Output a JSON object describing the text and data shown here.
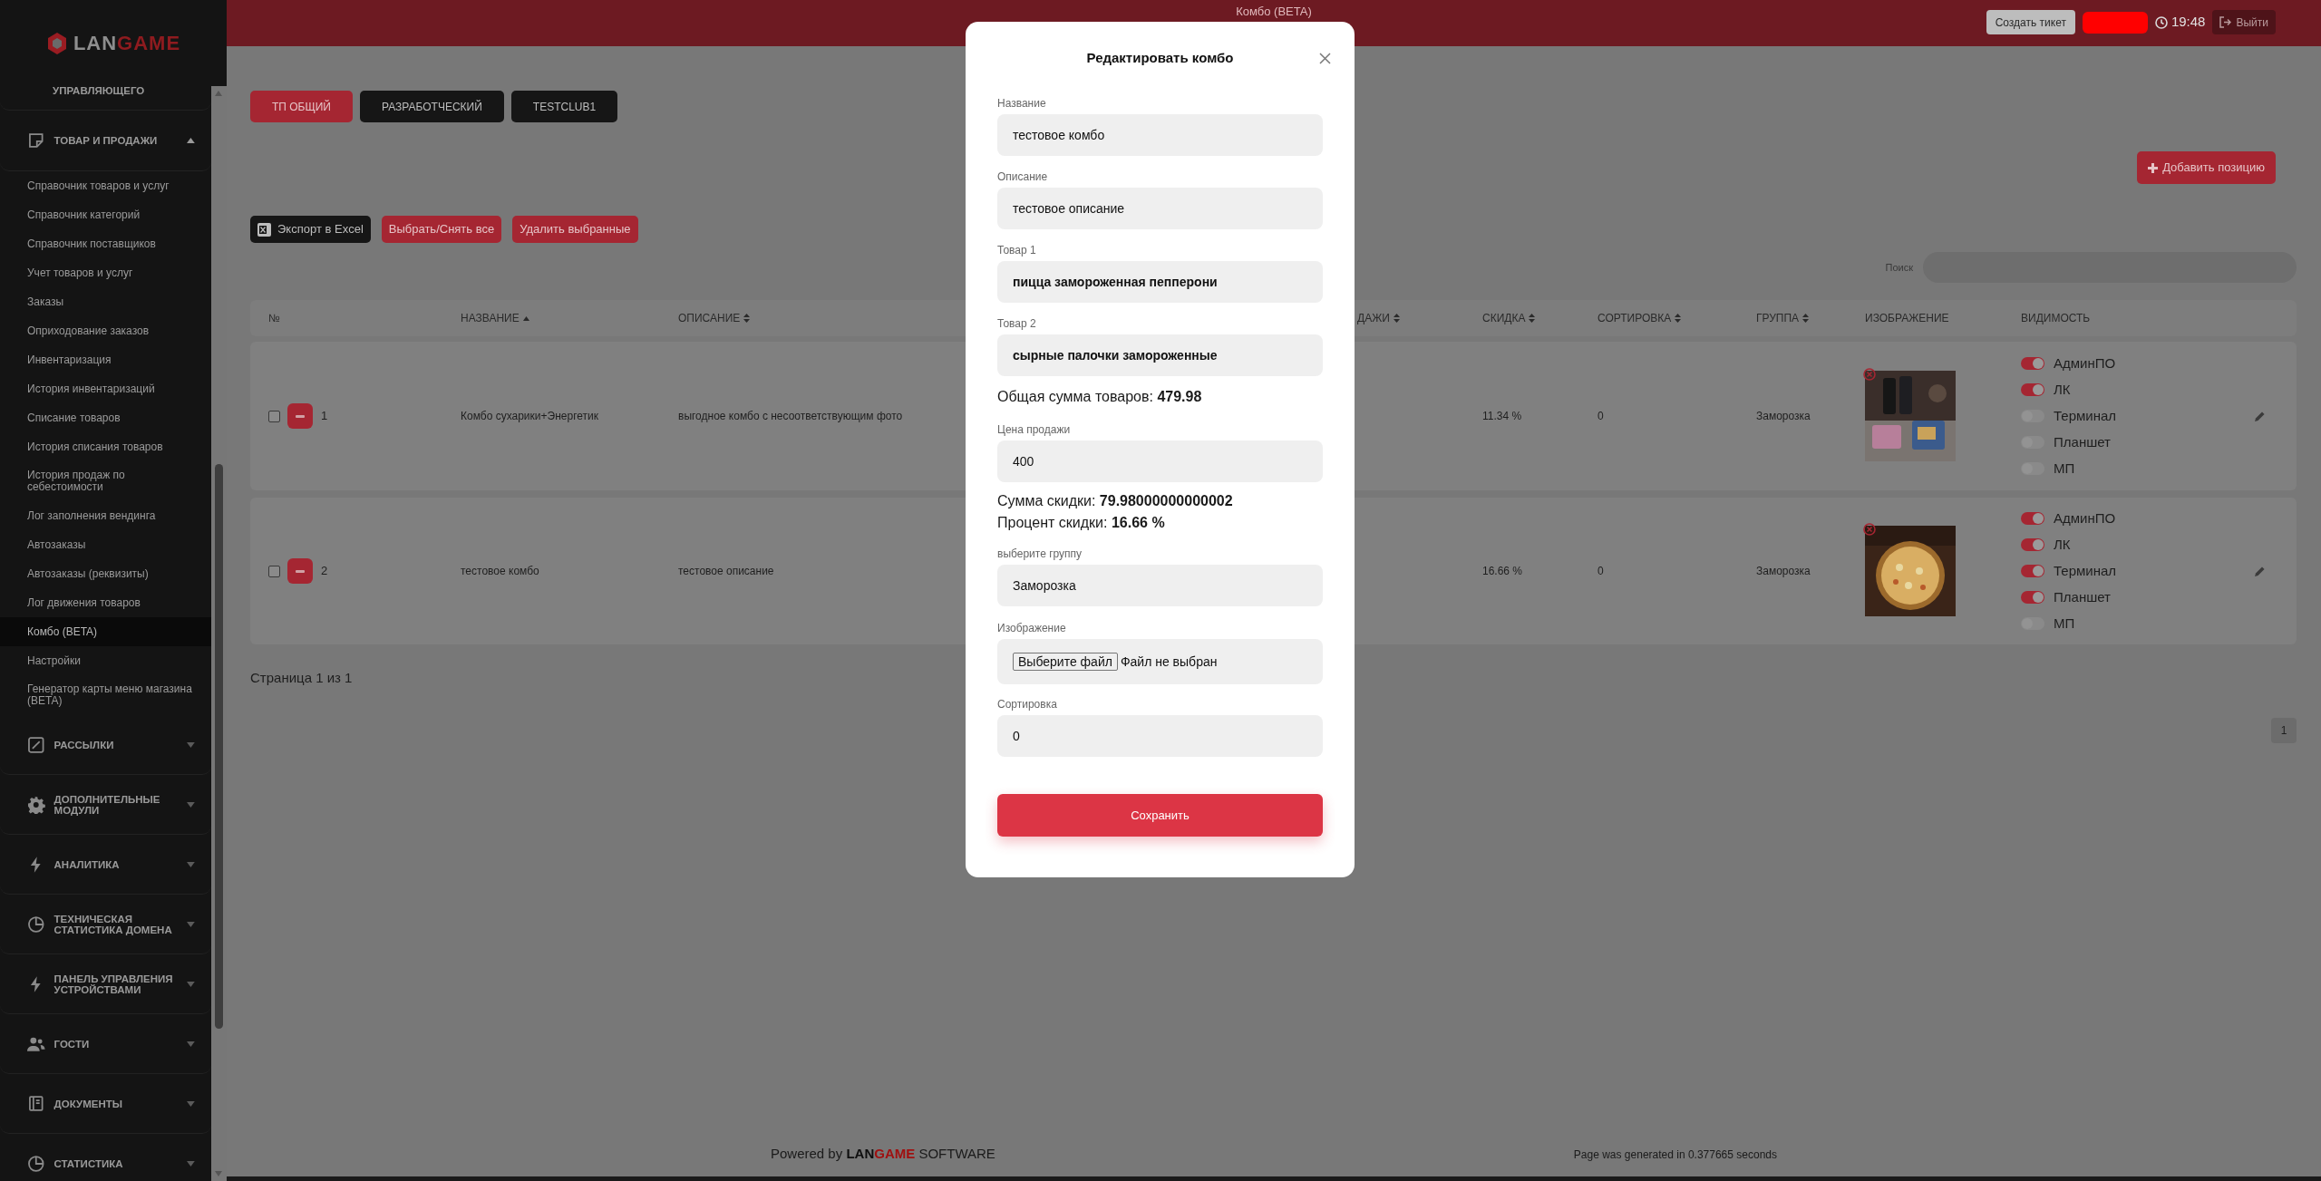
{
  "sidebar": {
    "logo": {
      "part_1": "LAN",
      "part_2": "GAME"
    },
    "partial_section": {
      "label": "УПРАВЛЯЮЩЕГО"
    },
    "sections": [
      {
        "label": "ТОВАР И ПРОДАЖИ",
        "expanded": true,
        "children": [
          {
            "label": "Справочник товаров и услуг",
            "selected": false
          },
          {
            "label": "Справочник категорий",
            "selected": false
          },
          {
            "label": "Справочник поставщиков",
            "selected": false
          },
          {
            "label": "Учет товаров и услуг",
            "selected": false
          },
          {
            "label": "Заказы",
            "selected": false
          },
          {
            "label": "Оприходование заказов",
            "selected": false
          },
          {
            "label": "Инвентаризация",
            "selected": false
          },
          {
            "label": "История инвентаризаций",
            "selected": false
          },
          {
            "label": "Списание товаров",
            "selected": false
          },
          {
            "label": "История списания товаров",
            "selected": false
          },
          {
            "label": "История продаж по себестоимости",
            "selected": false
          },
          {
            "label": "Лог заполнения вендинга",
            "selected": false
          },
          {
            "label": "Автозаказы",
            "selected": false
          },
          {
            "label": "Автозаказы (реквизиты)",
            "selected": false
          },
          {
            "label": "Лог движения товаров",
            "selected": false
          },
          {
            "label": "Комбо (BETA)",
            "selected": true
          },
          {
            "label": "Настройки",
            "selected": false
          },
          {
            "label": "Генератор карты меню магазина (BETA)",
            "selected": false
          }
        ]
      },
      {
        "label": "РАССЫЛКИ",
        "expanded": false
      },
      {
        "label": "ДОПОЛНИТЕЛЬНЫЕ МОДУЛИ",
        "expanded": false
      },
      {
        "label": "АНАЛИТИКА",
        "expanded": false
      },
      {
        "label": "ТЕХНИЧЕСКАЯ СТАТИСТИКА ДОМЕНА",
        "expanded": false
      },
      {
        "label": "ПАНЕЛЬ УПРАВЛЕНИЯ УСТРОЙСТВАМИ",
        "expanded": false
      },
      {
        "label": "ГОСТИ",
        "expanded": false
      },
      {
        "label": "ДОКУМЕНТЫ",
        "expanded": false
      },
      {
        "label": "СТАТИСТИКА",
        "expanded": false
      }
    ]
  },
  "header": {
    "title": "Комбо (BETA)",
    "create_ticket": "Создать тикет",
    "time": "19:48",
    "logout": "Выйти"
  },
  "club_tabs": [
    {
      "label": "ТП ОБЩИЙ",
      "selected": true
    },
    {
      "label": "РАЗРАБОТЧЕСКИЙ",
      "selected": false
    },
    {
      "label": "TESTCLUB1",
      "selected": false
    }
  ],
  "add_button": "Добавить позицию",
  "actions": [
    {
      "label": "Экспорт в Excel",
      "kind": "export"
    },
    {
      "label": "Выбрать/Снять все",
      "kind": "danger"
    },
    {
      "label": "Удалить выбранные",
      "kind": "danger"
    }
  ],
  "search": {
    "label": "Поиск"
  },
  "table": {
    "columns": [
      {
        "label": "№",
        "sortable": false,
        "sorted": false
      },
      {
        "label": "НАЗВАНИЕ",
        "sortable": true,
        "sorted": true
      },
      {
        "label": "ОПИСАНИЕ",
        "sortable": true,
        "sorted": false
      },
      {
        "label": "ДАЖИ",
        "sortable": true,
        "sorted": false
      },
      {
        "label": "СКИДКА",
        "sortable": true,
        "sorted": false
      },
      {
        "label": "СОРТИРОВКА",
        "sortable": true,
        "sorted": false
      },
      {
        "label": "ГРУППА",
        "sortable": true,
        "sorted": false
      },
      {
        "label": "ИЗОБРАЖЕНИЕ",
        "sortable": false,
        "sorted": false
      },
      {
        "label": "ВИДИМОСТЬ",
        "sortable": false,
        "sorted": false
      }
    ],
    "rows": [
      {
        "checked": false,
        "number": "1",
        "name": "Комбо сухарики+Энергетик",
        "description": "выгодное комбо с несоответствующим фото",
        "discount": "11.34 %",
        "sort": "0",
        "group": "Заморозка",
        "visibility": [
          {
            "label": "АдминПО",
            "on": true
          },
          {
            "label": "ЛК",
            "on": true
          },
          {
            "label": "Терминал",
            "on": false
          },
          {
            "label": "Планшет",
            "on": false
          },
          {
            "label": "МП",
            "on": false
          }
        ]
      },
      {
        "checked": false,
        "number": "2",
        "name": "тестовое комбо",
        "description": "тестовое описание",
        "discount": "16.66 %",
        "sort": "0",
        "group": "Заморозка",
        "visibility": [
          {
            "label": "АдминПО",
            "on": true
          },
          {
            "label": "ЛК",
            "on": true
          },
          {
            "label": "Терминал",
            "on": true
          },
          {
            "label": "Планшет",
            "on": true
          },
          {
            "label": "МП",
            "on": false
          }
        ]
      }
    ]
  },
  "pagination": {
    "summary": "Страница 1 из 1",
    "pages": [
      "1"
    ]
  },
  "modal": {
    "title": "Редактировать комбо",
    "fields": [
      {
        "kind": "input",
        "label": "Название",
        "value": "тестовое комбо"
      },
      {
        "kind": "input",
        "label": "Описание",
        "value": "тестовое описание"
      },
      {
        "kind": "select",
        "label": "Товар 1",
        "value": "пицца замороженная пепперони"
      },
      {
        "kind": "select",
        "label": "Товар 2",
        "value": "сырные палочки замороженные"
      },
      {
        "kind": "info",
        "lines": [
          "Общая сумма товаров: **479.98**"
        ]
      },
      {
        "kind": "input",
        "label": "Цена продажи",
        "value": "400"
      },
      {
        "kind": "info",
        "lines": [
          "Сумма скидки: **79.98000000000002**",
          "Процент скидки: **16.66 %**"
        ]
      },
      {
        "kind": "input",
        "label": "выберите группу",
        "value": "Заморозка"
      },
      {
        "kind": "file",
        "label": "Изображение",
        "button": "Выберите файл",
        "status": "Файл не выбран"
      },
      {
        "kind": "input",
        "label": "Сортировка",
        "value": "0"
      }
    ],
    "save": "Сохранить"
  },
  "footer": {
    "powered": {
      "before": "Powered by",
      "brand_1": "LAN",
      "brand_2": "GAME",
      "after": "SOFTWARE"
    },
    "generated": "Page was generated in 0.377665 seconds"
  }
}
